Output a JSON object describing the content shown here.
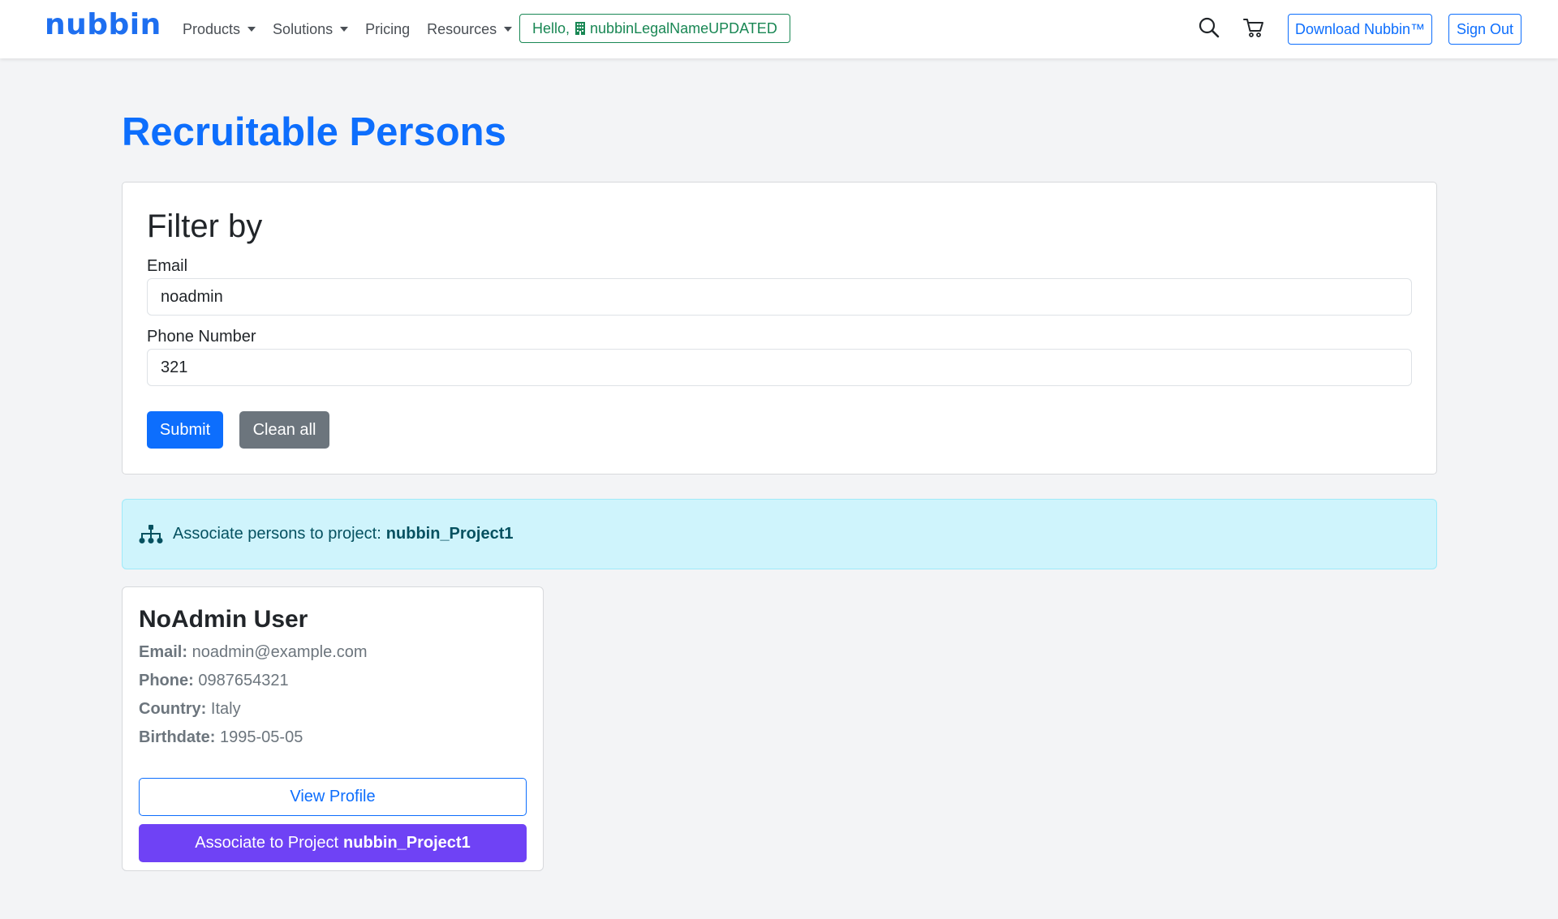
{
  "brand": {
    "name": "nubbin",
    "color": "#1e6ff0"
  },
  "nav": {
    "items": [
      {
        "label": "Products",
        "dropdown": true
      },
      {
        "label": "Solutions",
        "dropdown": true
      },
      {
        "label": "Pricing",
        "dropdown": false
      },
      {
        "label": "Resources",
        "dropdown": true
      }
    ],
    "greeting": {
      "prefix": "Hello,",
      "org_name": "nubbinLegalNameUPDATED",
      "icon": "building-icon"
    },
    "search_icon": "search-icon",
    "cart_icon": "cart-icon",
    "download_label": "Download Nubbin™",
    "signout_label": "Sign Out"
  },
  "page": {
    "title": "Recruitable Persons"
  },
  "filter": {
    "title": "Filter by",
    "email_label": "Email",
    "email_value": "noadmin",
    "phone_label": "Phone Number",
    "phone_value": "321",
    "submit_label": "Submit",
    "clean_label": "Clean all"
  },
  "alert": {
    "icon": "sitemap-icon",
    "text": "Associate persons to project:",
    "project": "nubbin_Project1"
  },
  "person": {
    "name": "NoAdmin User",
    "email_key": "Email:",
    "email": "noadmin@example.com",
    "phone_key": "Phone:",
    "phone": "0987654321",
    "country_key": "Country:",
    "country": "Italy",
    "birthdate_key": "Birthdate:",
    "birthdate": "1995-05-05",
    "view_label": "View Profile",
    "associate_prefix": "Associate to Project",
    "associate_project": "nubbin_Project1"
  },
  "colors": {
    "primary": "#0d6efd",
    "success": "#198754",
    "secondary": "#6c757d",
    "info_bg": "#cff4fc",
    "info_text": "#055160",
    "associate": "#6f42f5",
    "page_bg": "#f3f4f6"
  }
}
